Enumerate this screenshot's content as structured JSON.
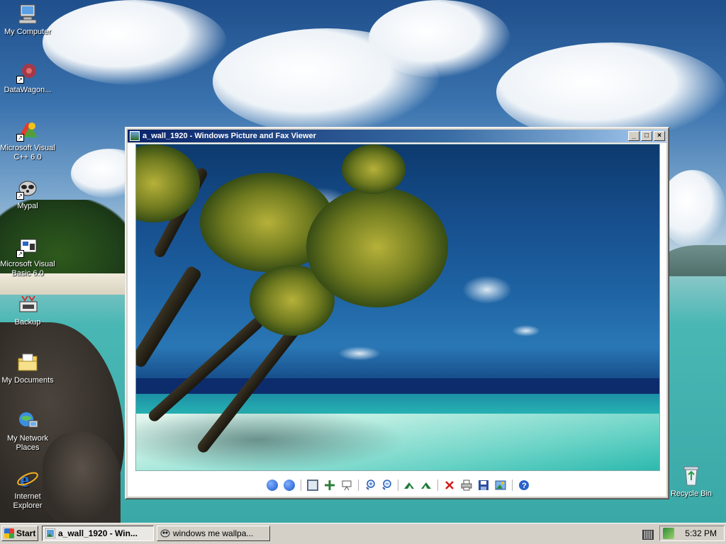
{
  "desktop": {
    "icons": [
      {
        "label": "My Computer",
        "icon": "my-computer-icon"
      },
      {
        "label": "DataWagon...",
        "icon": "datawagon-icon"
      },
      {
        "label": "Microsoft Visual C++ 6.0",
        "icon": "visual-cpp-icon"
      },
      {
        "label": "Mypal",
        "icon": "mypal-icon"
      },
      {
        "label": "Microsoft Visual Basic 6.0",
        "icon": "visual-basic-icon"
      },
      {
        "label": "Backup",
        "icon": "backup-icon"
      },
      {
        "label": "My Documents",
        "icon": "my-documents-icon"
      },
      {
        "label": "My Network Places",
        "icon": "network-places-icon"
      },
      {
        "label": "Internet Explorer",
        "icon": "internet-explorer-icon"
      }
    ],
    "recycle_bin": {
      "label": "Recycle Bin",
      "icon": "recycle-bin-icon"
    }
  },
  "window": {
    "title": "a_wall_1920 - Windows Picture and Fax Viewer",
    "controls": {
      "minimize": "_",
      "maximize": "□",
      "close": "×"
    },
    "image": {
      "name": "a_wall_1920",
      "description_icon": "beach-palm-photo"
    },
    "toolbar": [
      "previous-image-icon",
      "next-image-icon",
      "best-fit-icon",
      "actual-size-icon",
      "slideshow-icon",
      "zoom-in-icon",
      "zoom-out-icon",
      "rotate-clockwise-icon",
      "rotate-counterclockwise-icon",
      "delete-icon",
      "print-icon",
      "save-icon",
      "open-editor-icon",
      "help-icon"
    ]
  },
  "taskbar": {
    "start_label": "Start",
    "buttons": [
      {
        "label": "a_wall_1920 - Win...",
        "active": true
      },
      {
        "label": "windows me wallpa...",
        "active": false
      }
    ],
    "clock": "5:32 PM"
  },
  "colors": {
    "titlebar_start": "#0a246a",
    "titlebar_end": "#a6caf0",
    "chrome": "#d4d0c8"
  }
}
